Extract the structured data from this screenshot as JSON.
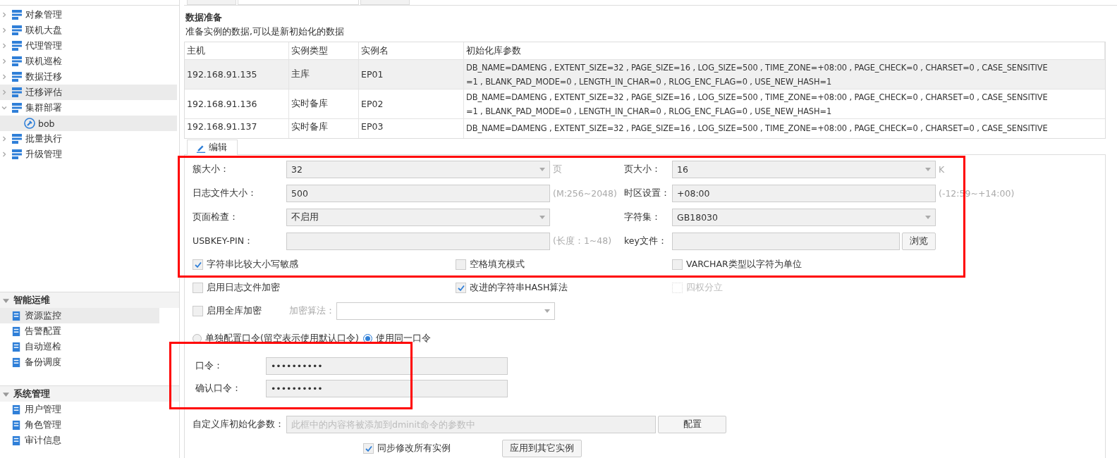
{
  "tabs": [
    {
      "selected": false
    },
    {
      "selected": true
    },
    {
      "selected": false
    }
  ],
  "sidebar": {
    "items": [
      {
        "label": "对象管理",
        "expanded": false,
        "selected": false
      },
      {
        "label": "联机大盘",
        "expanded": false,
        "selected": false
      },
      {
        "label": "代理管理",
        "expanded": false,
        "selected": false
      },
      {
        "label": "联机巡检",
        "expanded": false,
        "selected": false
      },
      {
        "label": "数据迁移",
        "expanded": false,
        "selected": false
      },
      {
        "label": "迁移评估",
        "expanded": false,
        "selected": true
      },
      {
        "label": "集群部署",
        "expanded": true,
        "selected": false,
        "children": [
          {
            "label": "bob",
            "selected": true
          }
        ]
      },
      {
        "label": "批量执行",
        "expanded": false,
        "selected": false
      },
      {
        "label": "升级管理",
        "expanded": false,
        "selected": false
      }
    ],
    "groups": [
      {
        "title": "智能运维",
        "expanded": true,
        "items": [
          {
            "label": "资源监控",
            "selected": true
          },
          {
            "label": "告警配置",
            "selected": false
          },
          {
            "label": "自动巡检",
            "selected": false
          },
          {
            "label": "备份调度",
            "selected": false
          }
        ]
      },
      {
        "title": "系统管理",
        "expanded": true,
        "items": [
          {
            "label": "用户管理",
            "selected": false
          },
          {
            "label": "角色管理",
            "selected": false
          },
          {
            "label": "审计信息",
            "selected": false
          }
        ]
      }
    ]
  },
  "section": {
    "title": "数据准备",
    "description": "准备实例的数据,可以是新初始化的数据"
  },
  "table": {
    "columns": [
      "主机",
      "实例类型",
      "实例名",
      "初始化库参数"
    ],
    "rows": [
      {
        "host": "192.168.91.135",
        "type": "主库",
        "name": "EP01",
        "selected": true,
        "params": [
          "DB_NAME=DAMENG , EXTENT_SIZE=32 , PAGE_SIZE=16 , LOG_SIZE=500 , TIME_ZONE=+08:00 , PAGE_CHECK=0 , CHARSET=0 , CASE_SENSITIVE",
          "=1 , BLANK_PAD_MODE=0 , LENGTH_IN_CHAR=0 , RLOG_ENC_FLAG=0 , USE_NEW_HASH=1"
        ]
      },
      {
        "host": "192.168.91.136",
        "type": "实时备库",
        "name": "EP02",
        "selected": false,
        "params": [
          "DB_NAME=DAMENG , EXTENT_SIZE=32 , PAGE_SIZE=16 , LOG_SIZE=500 , TIME_ZONE=+08:00 , PAGE_CHECK=0 , CHARSET=0 , CASE_SENSITIVE",
          "=1 , BLANK_PAD_MODE=0 , LENGTH_IN_CHAR=0 , RLOG_ENC_FLAG=0 , USE_NEW_HASH=1"
        ]
      },
      {
        "host": "192.168.91.137",
        "type": "实时备库",
        "name": "EP03",
        "selected": false,
        "params": [
          "DB_NAME=DAMENG , EXTENT_SIZE=32 , PAGE_SIZE=16 , LOG_SIZE=500 , TIME_ZONE=+08:00 , PAGE_CHECK=0 , CHARSET=0 , CASE_SENSITIVE"
        ]
      }
    ]
  },
  "edit_tab": {
    "label": "编辑",
    "selected": true
  },
  "form": {
    "rows": [
      [
        {
          "label": "簇大小：",
          "kind": "select",
          "value": "32",
          "suffix": "页"
        },
        {
          "label": "页大小：",
          "kind": "select",
          "value": "16",
          "suffix": "K"
        }
      ],
      [
        {
          "label": "日志文件大小：",
          "kind": "input",
          "value": "500",
          "suffix": "(M:256~2048)"
        },
        {
          "label": "时区设置：",
          "kind": "input",
          "value": "+08:00",
          "suffix": "(-12:59~+14:00)"
        }
      ],
      [
        {
          "label": "页面检查：",
          "kind": "select",
          "value": "不启用"
        },
        {
          "label": "字符集：",
          "kind": "select",
          "value": "GB18030"
        }
      ],
      [
        {
          "label": "USBKEY-PIN：",
          "kind": "input",
          "suffix": "(长度：1~48)"
        },
        {
          "label": "key文件：",
          "kind": "file",
          "button": "浏览"
        }
      ]
    ],
    "checkboxes": [
      {
        "label": "字符串比较大小写敏感",
        "checked": true,
        "disabled": false
      },
      {
        "label": "空格填充模式",
        "checked": false,
        "disabled": false
      },
      {
        "label": "VARCHAR类型以字符为单位",
        "checked": false,
        "disabled": false
      },
      {
        "label": "启用日志文件加密",
        "checked": false,
        "disabled": false
      },
      {
        "label": "改进的字符串HASH算法",
        "checked": true,
        "disabled": false
      },
      {
        "label": "四权分立",
        "checked": false,
        "disabled": true
      }
    ],
    "encryption": {
      "label": "启用全库加密",
      "checked": false,
      "algorithm_label": "加密算法："
    },
    "radios": [
      {
        "label": "单独配置口令(留空表示使用默认口令)",
        "selected": false
      },
      {
        "label": "使用同一口令",
        "selected": true
      }
    ],
    "passwords": [
      {
        "label": "口令：",
        "value": "••••••••••"
      },
      {
        "label": "确认口令：",
        "value": "••••••••••"
      }
    ],
    "custom": {
      "label": "自定义库初始化参数：",
      "placeholder": "此框中的内容将被添加到dminit命令的参数中",
      "button": "配置"
    },
    "footer": {
      "sync": {
        "label": "同步修改所有实例",
        "checked": true
      },
      "button": "应用到其它实例"
    }
  }
}
